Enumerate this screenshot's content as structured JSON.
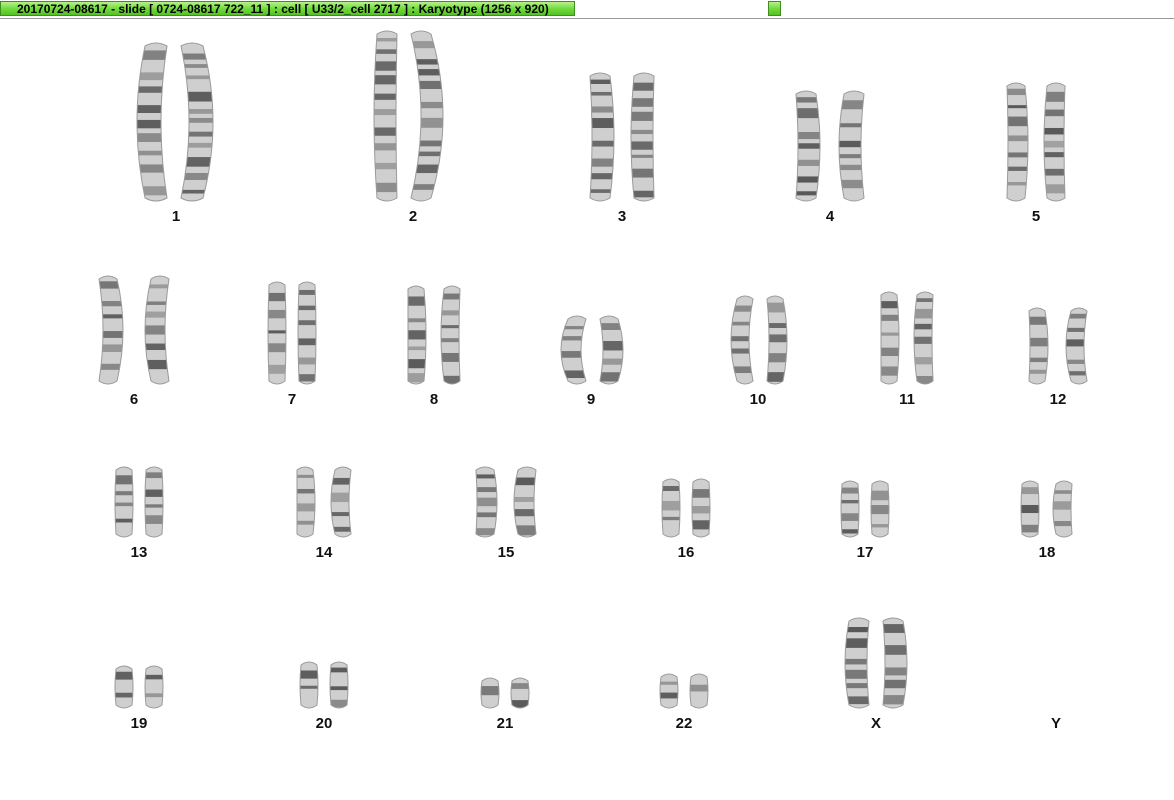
{
  "window": {
    "title": "20170724-08617 - slide [ 0724-08617 722_11 ] : cell [ U33/2_cell 2717 ] : Karyotype  (1256 x 920)"
  },
  "karyotype": {
    "chromosomes": [
      {
        "id": "1",
        "label": "1"
      },
      {
        "id": "2",
        "label": "2"
      },
      {
        "id": "3",
        "label": "3"
      },
      {
        "id": "4",
        "label": "4"
      },
      {
        "id": "5",
        "label": "5"
      },
      {
        "id": "6",
        "label": "6"
      },
      {
        "id": "7",
        "label": "7"
      },
      {
        "id": "8",
        "label": "8"
      },
      {
        "id": "9",
        "label": "9"
      },
      {
        "id": "10",
        "label": "10"
      },
      {
        "id": "11",
        "label": "11"
      },
      {
        "id": "12",
        "label": "12"
      },
      {
        "id": "13",
        "label": "13"
      },
      {
        "id": "14",
        "label": "14"
      },
      {
        "id": "15",
        "label": "15"
      },
      {
        "id": "16",
        "label": "16"
      },
      {
        "id": "17",
        "label": "17"
      },
      {
        "id": "18",
        "label": "18"
      },
      {
        "id": "19",
        "label": "19"
      },
      {
        "id": "20",
        "label": "20"
      },
      {
        "id": "21",
        "label": "21"
      },
      {
        "id": "22",
        "label": "22"
      },
      {
        "id": "X",
        "label": "X"
      },
      {
        "id": "Y",
        "label": "Y"
      }
    ]
  },
  "colors": {
    "title_tab": "#6ed83a",
    "chromatid_light": "#cfcfcf",
    "chromatid_band": "#4a4a4a"
  }
}
